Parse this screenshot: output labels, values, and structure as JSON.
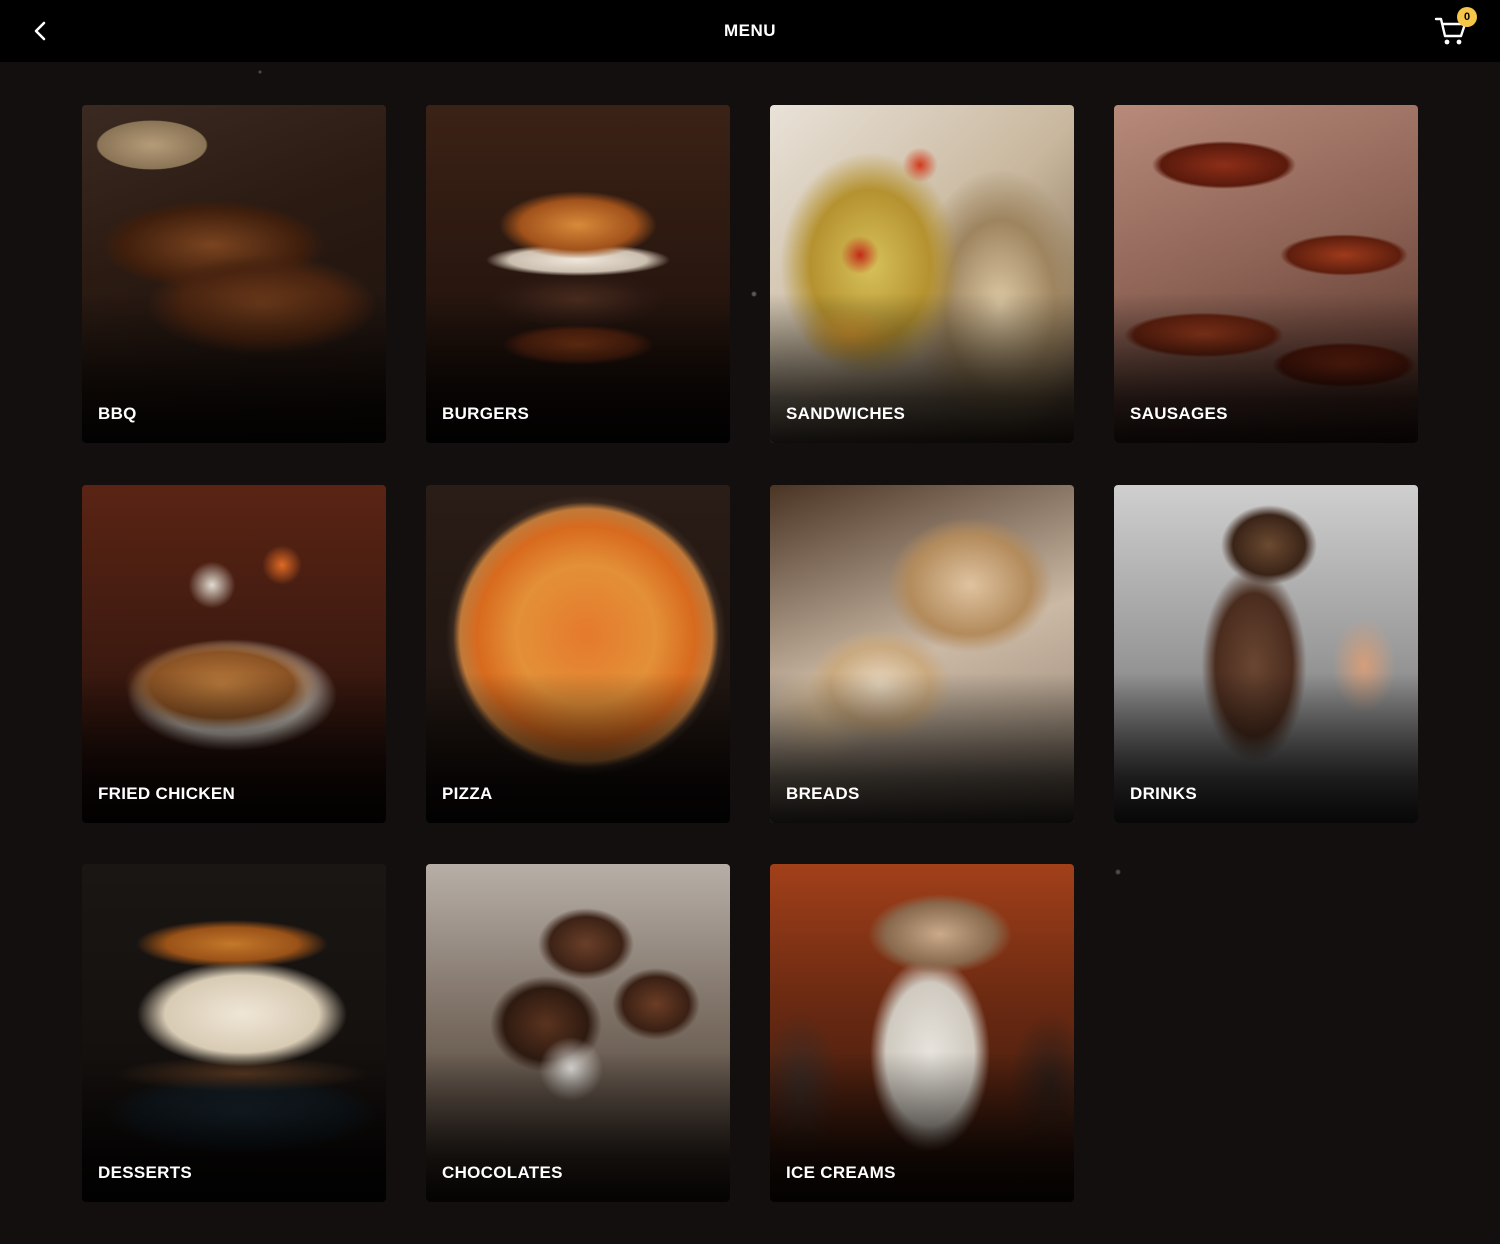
{
  "header": {
    "title": "MENU",
    "back_icon": "chevron-left-icon",
    "cart_icon": "cart-icon",
    "cart_count": "0",
    "cart_badge_color": "#f5c64a"
  },
  "categories": [
    {
      "label": "BBQ"
    },
    {
      "label": "BURGERS"
    },
    {
      "label": "SANDWICHES"
    },
    {
      "label": "SAUSAGES"
    },
    {
      "label": "FRIED CHICKEN"
    },
    {
      "label": "PIZZA"
    },
    {
      "label": "BREADS"
    },
    {
      "label": "DRINKS"
    },
    {
      "label": "DESSERTS"
    },
    {
      "label": "CHOCOLATES"
    },
    {
      "label": "ICE CREAMS"
    }
  ],
  "theme": {
    "background": "#130f0f",
    "header_background": "#000000",
    "text_color": "#ffffff"
  }
}
